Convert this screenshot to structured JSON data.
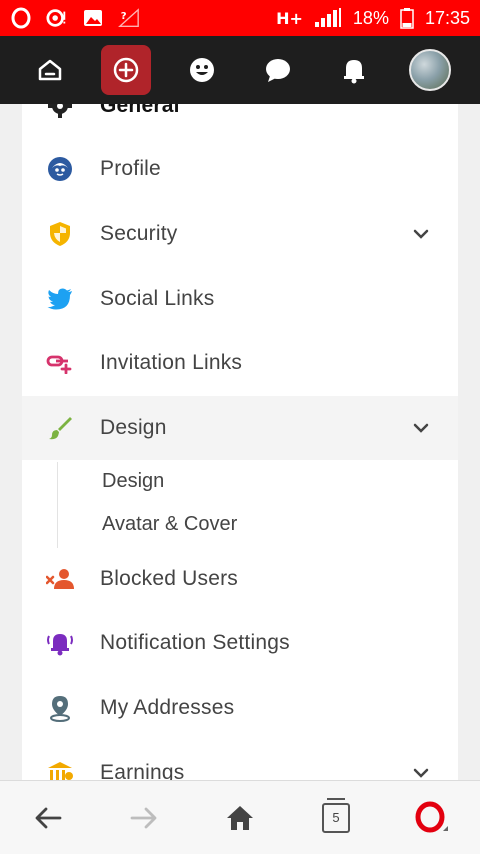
{
  "status_bar": {
    "network": "H+",
    "battery": "18%",
    "time": "17:35"
  },
  "header": {
    "nav": [
      "home-icon",
      "add-icon",
      "smiley-icon",
      "chat-icon",
      "bell-icon",
      "avatar"
    ]
  },
  "menu": {
    "general_label": "General",
    "items": [
      {
        "label": "Profile",
        "icon": "profile-icon"
      },
      {
        "label": "Security",
        "icon": "shield-icon"
      },
      {
        "label": "Social Links",
        "icon": "twitter-icon"
      },
      {
        "label": "Invitation Links",
        "icon": "link-add-icon"
      },
      {
        "label": "Design",
        "icon": "brush-icon"
      },
      {
        "label": "Blocked Users",
        "icon": "blocked-user-icon"
      },
      {
        "label": "Notification Settings",
        "icon": "bell-icon"
      },
      {
        "label": "My Addresses",
        "icon": "location-icon"
      },
      {
        "label": "Earnings",
        "icon": "bank-icon"
      }
    ],
    "design_sub": [
      "Design",
      "Avatar & Cover"
    ]
  },
  "browser_bar": {
    "tab_count": "5"
  },
  "colors": {
    "status": "#ff0000",
    "header": "#1e1e1e",
    "active_header_btn": "#b0242a",
    "shield": "#f5b400",
    "twitter": "#1da1f2",
    "invite": "#d6336c",
    "brush": "#7cb342",
    "blocked": "#e4572e",
    "notify": "#7b2cbf",
    "location": "#546e7a",
    "earnings": "#f2a900",
    "opera": "#e3000f"
  }
}
